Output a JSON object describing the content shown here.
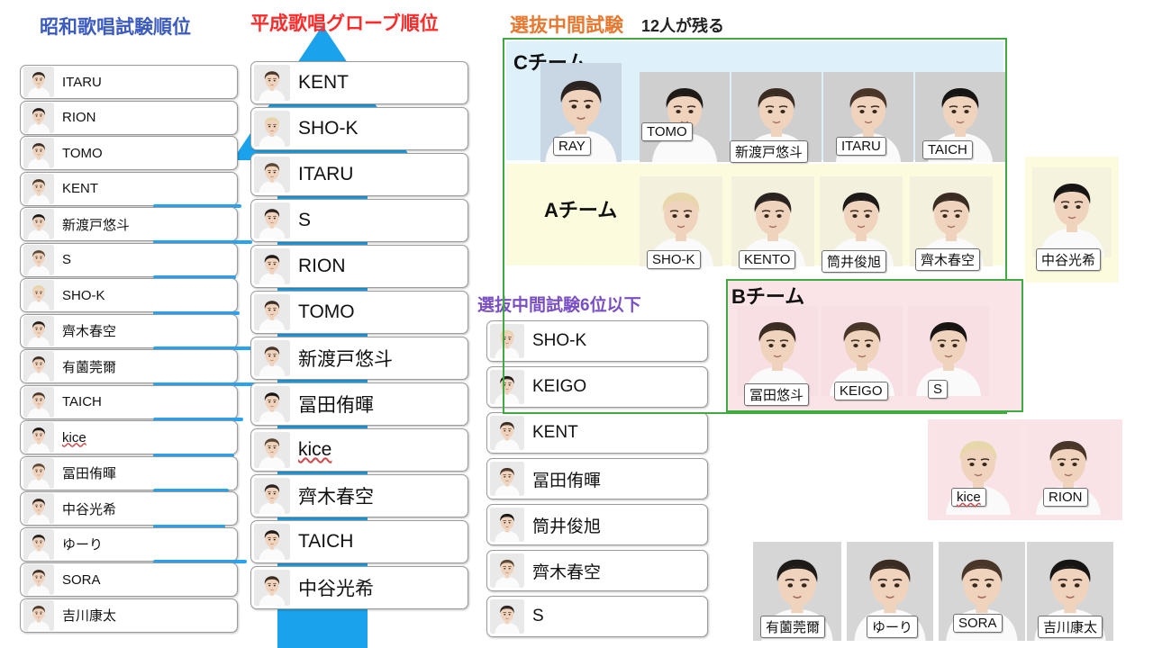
{
  "headings": {
    "showa": "昭和歌唱試験順位",
    "heisei": "平成歌唱グローブ順位",
    "senbatsu": "選抜中間試験",
    "remaining": "12人が残る",
    "below6": "選抜中間試験6位以下"
  },
  "colors": {
    "showa_heading": "#3b5bbf",
    "heisei_heading": "#ff2a2a",
    "senbatsu_heading": "#e8782f",
    "below6_heading": "#7a4fc4",
    "arrow": "#29a3f0",
    "green_border": "#3faa3f",
    "c_team_bg": "#def1fb",
    "a_team_bg": "#fcfbdd",
    "b_team_bg": "#fbe4e8"
  },
  "showa_list": [
    {
      "name": "ITARU",
      "bar": 0
    },
    {
      "name": "RION",
      "bar": 0
    },
    {
      "name": "TOMO",
      "bar": 0
    },
    {
      "name": "KENT",
      "bar": 1
    },
    {
      "name": "新渡戸悠斗",
      "bar": 1
    },
    {
      "name": "S",
      "bar": 1
    },
    {
      "name": "SHO-K",
      "bar": 1
    },
    {
      "name": "齊木春空",
      "bar": 1
    },
    {
      "name": "有薗莞爾",
      "bar": 1
    },
    {
      "name": "TAICH",
      "bar": 1
    },
    {
      "name": "kice",
      "bar": 1,
      "wavy": true
    },
    {
      "name": "冨田侑暉",
      "bar": 1
    },
    {
      "name": "中谷光希",
      "bar": 1
    },
    {
      "name": "ゆーり",
      "bar": 1
    },
    {
      "name": "SORA",
      "bar": 0
    },
    {
      "name": "吉川康太",
      "bar": 0
    }
  ],
  "heisei_list": [
    {
      "name": "KENT"
    },
    {
      "name": "SHO-K"
    },
    {
      "name": "ITARU"
    },
    {
      "name": "S"
    },
    {
      "name": "RION"
    },
    {
      "name": "TOMO"
    },
    {
      "name": "新渡戸悠斗"
    },
    {
      "name": "冨田侑暉"
    },
    {
      "name": "kice",
      "wavy": true
    },
    {
      "name": "齊木春空"
    },
    {
      "name": "TAICH"
    },
    {
      "name": "中谷光希"
    }
  ],
  "below6_list": [
    {
      "name": "SHO-K"
    },
    {
      "name": "KEIGO"
    },
    {
      "name": "KENT"
    },
    {
      "name": "冨田侑暉"
    },
    {
      "name": "筒井俊旭"
    },
    {
      "name": "齊木春空"
    },
    {
      "name": "S"
    }
  ],
  "teams": {
    "c_label": "Cチーム",
    "a_label": "Aチーム",
    "b_label": "Bチーム",
    "c_members": [
      "RAY",
      "TOMO",
      "新渡戸悠斗",
      "ITARU",
      "TAICH"
    ],
    "a_members": [
      "SHO-K",
      "KENTO",
      "筒井俊旭",
      "齊木春空"
    ],
    "b_members": [
      "冨田悠斗",
      "KEIGO",
      "S"
    ]
  },
  "side_members": {
    "yellow": [
      "中谷光希"
    ],
    "pink": [
      "kice",
      "RION"
    ],
    "bottom": [
      "有薗莞爾",
      "ゆーり",
      "SORA",
      "吉川康太"
    ]
  }
}
